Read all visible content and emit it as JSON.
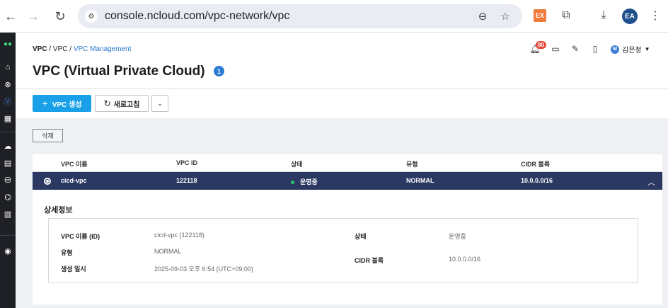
{
  "browser": {
    "url": "console.ncloud.com/vpc-network/vpc",
    "extension_label": "EX",
    "profile_initials": "EA"
  },
  "rail": {
    "icons": [
      "ncloud-logo-icon",
      "home-icon",
      "close-circle-icon",
      "vpc-icon",
      "grid-icon",
      "cloud-icon",
      "server-icon",
      "database-icon",
      "storage-icon",
      "chart-icon",
      "support-icon"
    ]
  },
  "header": {
    "breadcrumb": [
      "VPC",
      "VPC",
      "VPC Management"
    ],
    "breadcrumb_sep": "/",
    "notification_count": "80",
    "user_name": "김은정",
    "user_initial": "M"
  },
  "page": {
    "title": "VPC (Virtual Private Cloud)",
    "count_badge": "1"
  },
  "toolbar": {
    "create_label": "VPC 생성",
    "refresh_label": "새로고침",
    "delete_label": "삭제"
  },
  "table": {
    "columns": [
      "VPC 이름",
      "VPC ID",
      "상태",
      "유형",
      "CIDR 블록"
    ],
    "rows": [
      {
        "name": "cicd-vpc",
        "id": "122118",
        "status": "운영중",
        "type": "NORMAL",
        "cidr": "10.0.0.0/16"
      }
    ]
  },
  "detail": {
    "title": "상세정보",
    "left": [
      {
        "label": "VPC 이름 (ID)",
        "value": "cicd-vpc (122118)"
      },
      {
        "label": "유형",
        "value": "NORMAL"
      },
      {
        "label": "생성 일시",
        "value": "2025-09-03 오후 6:54 (UTC+09:00)"
      }
    ],
    "right": [
      {
        "label": "상태",
        "value": "운영중"
      },
      {
        "label": "CIDR 블록",
        "value": "10.0.0.0/16"
      }
    ]
  },
  "colors": {
    "primary": "#19a0e9",
    "selected_row": "#2b3862",
    "status_green": "#28c76f",
    "link": "#2a7bd1"
  }
}
